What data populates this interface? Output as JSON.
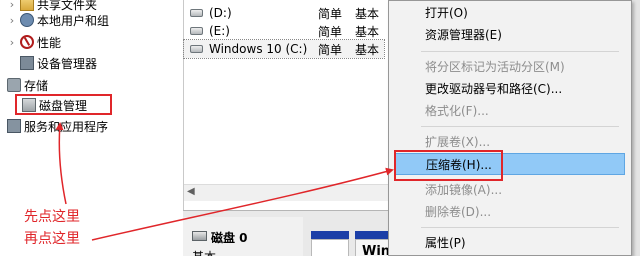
{
  "tree": {
    "items": [
      {
        "label": "共享文件夹",
        "chev": "›"
      },
      {
        "label": "本地用户和组",
        "chev": "›"
      },
      {
        "label": "性能",
        "chev": "›"
      },
      {
        "label": "设备管理器",
        "chev": ""
      },
      {
        "label": "存储",
        "chev": ""
      },
      {
        "label": "磁盘管理",
        "chev": ""
      },
      {
        "label": "服务和应用程序",
        "chev": "›"
      }
    ]
  },
  "volumes": [
    {
      "name": "(D:)",
      "layout": "简单",
      "type": "基本"
    },
    {
      "name": "(E:)",
      "layout": "简单",
      "type": "基本"
    },
    {
      "name": "Windows 10 (C:)",
      "layout": "简单",
      "type": "基本"
    }
  ],
  "disk": {
    "name": "磁盘 0",
    "type": "基本",
    "partition_label": "Win"
  },
  "context_menu": {
    "items": [
      {
        "label": "打开(O)",
        "enabled": true
      },
      {
        "label": "资源管理器(E)",
        "enabled": true
      },
      {
        "label": "将分区标记为活动分区(M)",
        "enabled": false
      },
      {
        "label": "更改驱动器号和路径(C)...",
        "enabled": true
      },
      {
        "label": "格式化(F)...",
        "enabled": false
      },
      {
        "label": "扩展卷(X)...",
        "enabled": false
      },
      {
        "label": "压缩卷(H)...",
        "enabled": true,
        "highlighted": true
      },
      {
        "label": "添加镜像(A)...",
        "enabled": false
      },
      {
        "label": "删除卷(D)...",
        "enabled": false
      },
      {
        "label": "属性(P)",
        "enabled": true
      }
    ]
  },
  "annotations": {
    "first_click": "先点这里",
    "then_click": "再点这里"
  },
  "colors": {
    "annotation_red": "#e0262a",
    "menu_highlight": "#91c9f7",
    "partition_bar": "#1c3fa7"
  }
}
